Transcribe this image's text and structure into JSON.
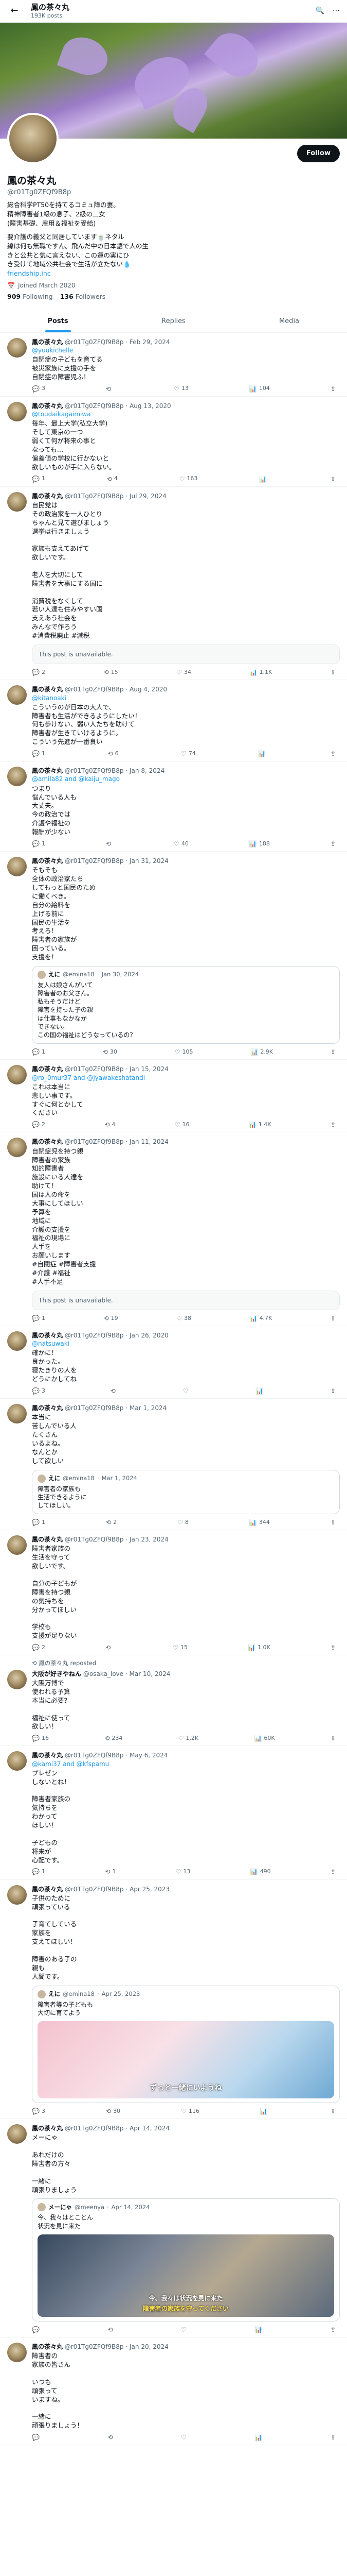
{
  "topbar": {
    "title": "鳳の茶々丸",
    "post_count": "193K posts",
    "back_icon": "arrow-left-icon",
    "search_icon": "search-icon",
    "more_icon": "more-icon"
  },
  "profile": {
    "name": "鳳の茶々丸",
    "handle": "@r01Tg0ZFQf9B8p",
    "follow_label": "Follow",
    "bio": [
      "総合科学PT50を持てるコミュ障の妻。",
      "精神障害者1級の息子、2級の二女",
      "(障害基礎、雇用＆福祉を受給)",
      "",
      "要介護の義父と同居しています🍵ネタル",
      "線は何も無職ですん。飛んだ中の日本語で人の生",
      "きと公共と気に言えない、この運の実にひ",
      "き受けて地域公共社会で生活が立たない💧"
    ],
    "bio_link": "friendship.inc",
    "joined": "Joined March 2020",
    "following_count": "909",
    "following_label": "Following",
    "followers_count": "136",
    "followers_label": "Followers"
  },
  "tabs": [
    "Posts",
    "Replies",
    "Media"
  ],
  "tweets": [
    {
      "name": "鳳の茶々丸",
      "handle": "@r01Tg0ZFQf9B8p",
      "date": "Feb 29, 2024",
      "reply_to": "@yuukichelle",
      "text": "自閉症の子どもを育てる\n被災家族に支援の手を\n自閉症の障害児ふ！",
      "stats": [
        "3",
        "",
        "13",
        "104"
      ]
    },
    {
      "name": "鳳の茶々丸",
      "handle": "@r01Tg0ZFQf9B8p",
      "date": "Aug 13, 2020",
      "reply_to": "@toudaikagaimiwa",
      "text": "毎年、最上大学(私立大学)\nそして東京の一つ\n弱くて何が将来の事と\nなっても…\n偏差値の学校に行かないと\n欲しいものが手に入らない。",
      "stats": [
        "1",
        "4",
        "163",
        ""
      ]
    },
    {
      "name": "鳳の茶々丸",
      "handle": "@r01Tg0ZFQf9B8p",
      "date": "Jul 29, 2024",
      "reply_to": "",
      "text": "自民党は\nその政治家を一人ひとり\nちゃんと見て選びましょう\n選挙は行きましょう\n\n家族も支えてあげて\n欲しいです。\n\n老人を大切にして\n障害者を大事にする国に\n\n消費税をなくして\n若い人達も住みやすい国\n支えあう社会を\nみんなで作ろう\n#消費税廃止 #減税",
      "unavailable": "This post is unavailable.",
      "stats": [
        "2",
        "15",
        "34",
        "1.1K"
      ]
    },
    {
      "name": "鳳の茶々丸",
      "handle": "@r01Tg0ZFQf9B8p",
      "date": "Aug 4, 2020",
      "reply_to": "@kitanoaki",
      "text": "こういうのが日本の大人で、\n障害者も生活ができるようにしたい！\n何も歩けない、弱い人たちを助けて\n障害者が生きていけるように。\nこういう先進が一番良い",
      "stats": [
        "1",
        "6",
        "74",
        ""
      ]
    },
    {
      "name": "鳳の茶々丸",
      "handle": "@r01Tg0ZFQf9B8p",
      "date": "Jan 8, 2024",
      "reply_to": "@amila82 and @kaiju_mago",
      "text": "つまり\n悩んでいる人も\n大丈夫。\n今の政治では\n介護や福祉の\n報酬が少ない",
      "stats": [
        "1",
        "",
        "40",
        "188"
      ]
    },
    {
      "name": "鳳の茶々丸",
      "handle": "@r01Tg0ZFQf9B8p",
      "date": "Jan 31, 2024",
      "reply_to": "",
      "text": "そもそも\n全体の政治家たち\nしてもっと国民のため\nに働くべき。\n自分の給料を\n上げる前に\n国民の生活を\n考えろ！\n障害者の家族が\n困っている。\n支援を！",
      "quote": {
        "name": "えに",
        "handle": "@emina18",
        "date": "Jan 30, 2024",
        "text": "友人は娘さんがいて\n障害者のお父さん。\n私もそうだけど\n障害を持った子の親\nは仕事もなかなか\nできない。\nこの国の福祉はどうなっているの？"
      },
      "stats": [
        "1",
        "30",
        "105",
        "2.9K"
      ]
    },
    {
      "name": "鳳の茶々丸",
      "handle": "@r01Tg0ZFQf9B8p",
      "date": "Jan 15, 2024",
      "reply_to": "@ro_0mur37 and @jyawakeshatandi",
      "text": "これは本当に\n悲しい事です。\nすぐに何とかして\nください",
      "stats": [
        "2",
        "4",
        "16",
        "1.4K"
      ]
    },
    {
      "name": "鳳の茶々丸",
      "handle": "@r01Tg0ZFQf9B8p",
      "date": "Jan 11, 2024",
      "reply_to": "",
      "text": "自閉症児を持つ親\n障害者の家族\n知的障害者\n施設にいる人達を\n助けて！\n国は人の命を\n大事にしてほしい\n予算を\n地域に\n介護の支援を\n福祉の現場に\n人手を\nお願いします\n#自閉症 #障害者支援\n#介護 #福祉\n#人手不足",
      "unavailable": "This post is unavailable.",
      "stats": [
        "1",
        "19",
        "38",
        "4.7K"
      ]
    },
    {
      "name": "鳳の茶々丸",
      "handle": "@r01Tg0ZFQf9B8p",
      "date": "Jan 26, 2020",
      "reply_to": "@natsuwaki",
      "text": "確かに！\n良かった。\n寝たきりの人を\nどうにかしてね",
      "stats": [
        "3",
        "",
        "",
        ""
      ]
    },
    {
      "name": "鳳の茶々丸",
      "handle": "@r01Tg0ZFQf9B8p",
      "date": "Mar 1, 2024",
      "reply_to": "",
      "text": "本当に\n苦しんでいる人\nたくさん\nいるよね。\nなんとか\nして欲しい",
      "quote": {
        "name": "えに",
        "handle": "@emina18",
        "date": "Mar 1, 2024",
        "text": "障害者の家族も\n生活できるように\nしてほしい。"
      },
      "stats": [
        "1",
        "2",
        "8",
        "344"
      ]
    },
    {
      "name": "鳳の茶々丸",
      "handle": "@r01Tg0ZFQf9B8p",
      "date": "Jan 23, 2024",
      "reply_to": "",
      "text": "障害者家族の\n生活を守って\n欲しいです。\n\n自分の子どもが\n障害を持つ親\nの気持ちを\n分かってほしい\n\n学校も\n支援が足りない",
      "stats": [
        "2",
        "",
        "15",
        "1.0K"
      ]
    }
  ],
  "retweet": {
    "header": "鳳の茶々丸 reposted",
    "name": "大阪が好きやねん",
    "handle": "@osaka_love",
    "date": "Mar 10, 2024",
    "text": "大阪万博で\n使われる予算\n本当に必要？\n\n福祉に使って\n欲しい！",
    "stats": [
      "16",
      "234",
      "1.2K",
      "60K"
    ]
  },
  "tweets2": [
    {
      "name": "鳳の茶々丸",
      "handle": "@r01Tg0ZFQf9B8p",
      "date": "May 6, 2024",
      "reply_to": "@kami37 and @kfspamu",
      "text": "プレゼン\nしないとね！\n\n障害者家族の\n気持ちを\nわかって\nほしい！\n\n子どもの\n将来が\n心配です。",
      "stats": [
        "1",
        "1",
        "13",
        "490"
      ]
    },
    {
      "name": "鳳の茶々丸",
      "handle": "@r01Tg0ZFQf9B8p",
      "date": "Apr 25, 2023",
      "reply_to": "",
      "text": "子供のために\n頑張っている\n\n子育てしている\n家族を\n支えてほしい！\n\n障害のある子の\n親も\n人間です。",
      "quote": {
        "name": "えに",
        "handle": "@emina18",
        "date": "Apr 25, 2023",
        "text": "障害者等の子どもも\n大切に育てよう",
        "image_caption": "ずっと一緒にいようね"
      },
      "stats": [
        "3",
        "30",
        "116",
        ""
      ]
    },
    {
      "name": "鳳の茶々丸",
      "handle": "@r01Tg0ZFQf9B8p",
      "date": "Apr 14, 2024",
      "reply_to": "",
      "text": "メーにゃ\n\nあれだけの\n障害者の方々\n\n一緒に\n頑張りましょう",
      "quote": {
        "name": "メーにゃ",
        "handle": "@meenya",
        "date": "Apr 14, 2024",
        "text": "今、我々はとことん\n状況を見に来た",
        "image_caption": "今、我々は状況を見に来た",
        "image_caption2": "障害者の家族を守ってください"
      },
      "stats": [
        "",
        "",
        "",
        ""
      ]
    },
    {
      "name": "鳳の茶々丸",
      "handle": "@r01Tg0ZFQf9B8p",
      "date": "Jan 20, 2024",
      "reply_to": "",
      "text": "障害者の\n家族の皆さん\n\nいつも\n頑張って\nいますね。\n\n一緒に\n頑張りましょう！",
      "stats": [
        "",
        "",
        "",
        ""
      ]
    }
  ]
}
